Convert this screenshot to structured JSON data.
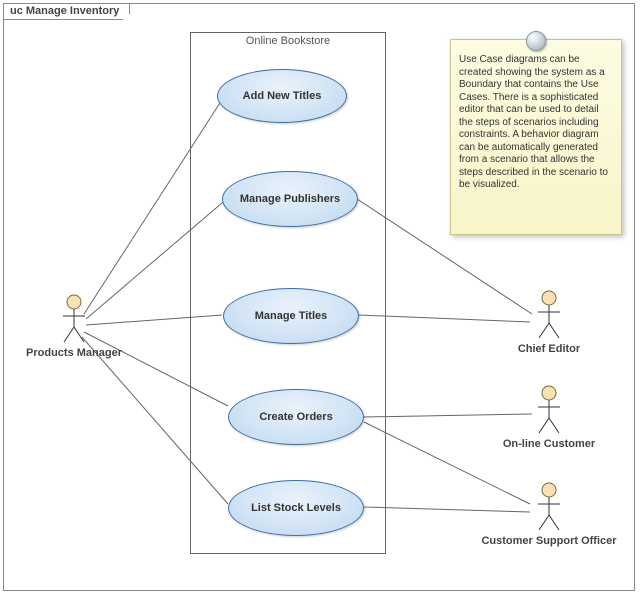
{
  "frame": {
    "title": "uc Manage Inventory"
  },
  "boundary": {
    "title": "Online Bookstore"
  },
  "usecases": {
    "add_new_titles": "Add New Titles",
    "manage_publishers": "Manage Publishers",
    "manage_titles": "Manage Titles",
    "create_orders": "Create Orders",
    "list_stock_levels": "List Stock Levels"
  },
  "actors": {
    "products_manager": "Products Manager",
    "chief_editor": "Chief Editor",
    "online_customer": "On-line Customer",
    "customer_support_officer": "Customer Support Officer"
  },
  "note": "Use Case diagrams can be created showing the system as a Boundary that contains the Use Cases. There is a sophisticated editor that can be used to detail the steps of scenarios including constraints. A behavior diagram can be automatically generated from a scenario that allows the steps described in the scenario to be visualized.",
  "associations": [
    [
      "products_manager",
      "add_new_titles"
    ],
    [
      "products_manager",
      "manage_publishers"
    ],
    [
      "products_manager",
      "manage_titles"
    ],
    [
      "products_manager",
      "create_orders"
    ],
    [
      "products_manager",
      "list_stock_levels"
    ],
    [
      "chief_editor",
      "manage_publishers"
    ],
    [
      "chief_editor",
      "manage_titles"
    ],
    [
      "online_customer",
      "create_orders"
    ],
    [
      "customer_support_officer",
      "create_orders"
    ],
    [
      "customer_support_officer",
      "list_stock_levels"
    ]
  ]
}
